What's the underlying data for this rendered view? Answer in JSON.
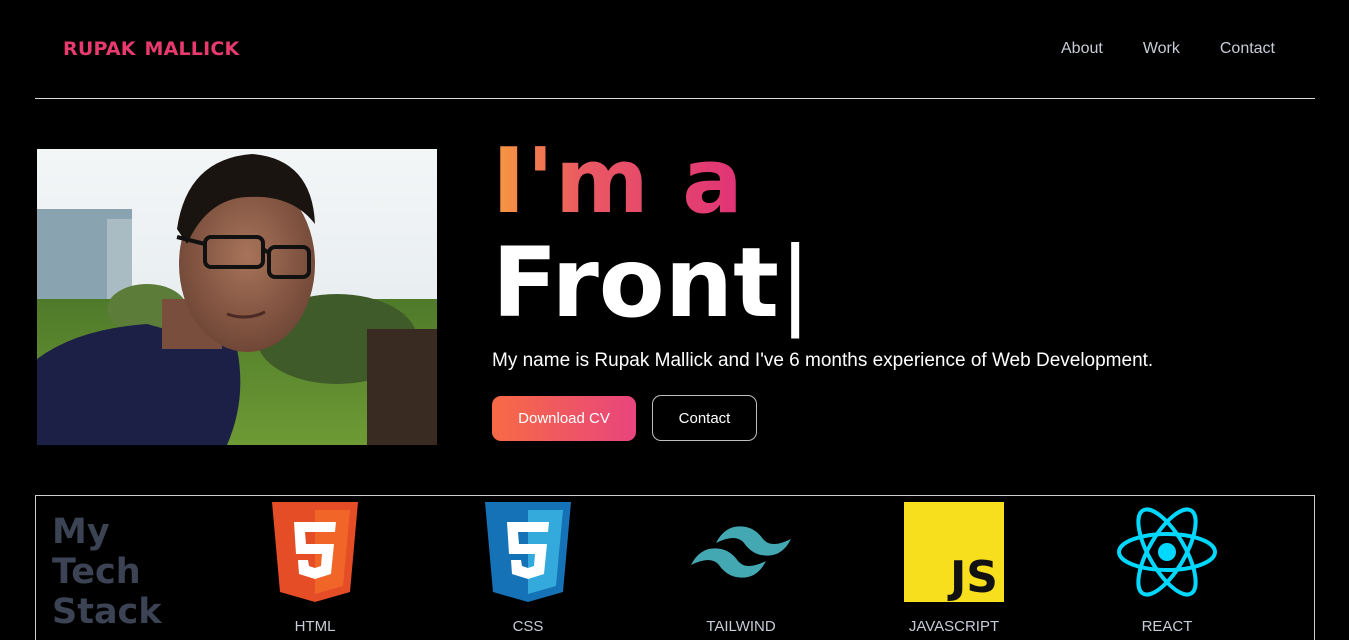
{
  "header": {
    "brand": "RUPAK MALLICK",
    "nav": [
      "About",
      "Work",
      "Contact"
    ]
  },
  "hero": {
    "title": "I'm a",
    "role": "Front",
    "cursor": "|",
    "description": "My name is Rupak Mallick and I've 6 months experience of Web Development.",
    "primary_button": "Download CV",
    "secondary_button": "Contact"
  },
  "stack": {
    "title_lines": [
      "My",
      "Tech",
      "Stack"
    ],
    "items": [
      {
        "label": "HTML",
        "icon": "html5-icon",
        "color": "#e44d26"
      },
      {
        "label": "CSS",
        "icon": "css3-icon",
        "color": "#1572b6"
      },
      {
        "label": "TAILWIND",
        "icon": "tailwind-icon",
        "color": "#44a8b3"
      },
      {
        "label": "JAVASCRIPT",
        "icon": "javascript-icon",
        "color": "#f7df1e"
      },
      {
        "label": "REACT",
        "icon": "react-icon",
        "color": "#00d8ff"
      }
    ]
  },
  "colors": {
    "brand": "#e83a6e",
    "gradient_start": "#f79a3e",
    "gradient_end": "#e03277",
    "background": "#000000"
  }
}
